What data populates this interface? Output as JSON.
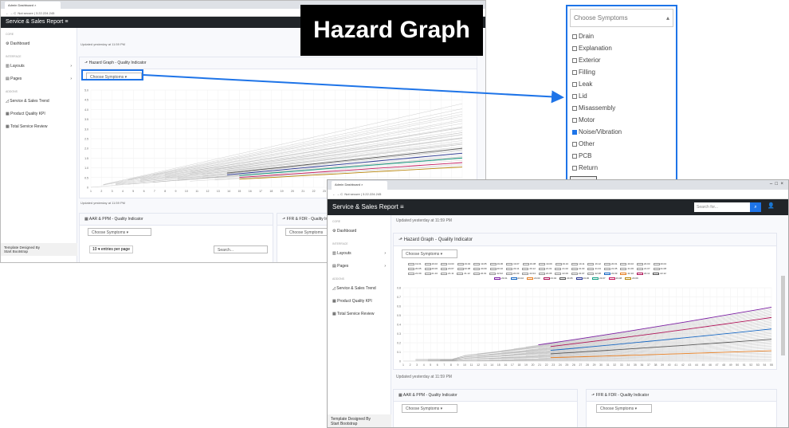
{
  "title_banner": "Hazard Graph",
  "win1": {
    "tab_title": "Admin Dashboard",
    "url": "Not secure | 3.22.224.245",
    "brand": "Service & Sales Report",
    "updated_top": "Updated yesterday at 11:59 PM",
    "card_title": "Hazard Graph - Quality Indicator",
    "select": "Choose Symptoms",
    "updated_bottom": "Updated yesterday at 11:59 PM",
    "aar_title": "AAR & PPM - Quality Indicator",
    "ffr_title": "FFR & FDR - Quality Indi",
    "entries": "10 ▾ entries per page",
    "search_ph": "Search...",
    "sidebar": {
      "core": "CORE",
      "dashboard": "Dashboard",
      "interface": "INTERFACE",
      "layouts": "Layouts",
      "pages": "Pages",
      "addons": "ADDONS",
      "trend": "Service & Sales Trend",
      "kpi": "Product Quality KPI",
      "review": "Total Service Review",
      "footer1": "Template Designed By",
      "footer2": "Start Bootstrap"
    },
    "y_ticks": [
      "5.0",
      "4.5",
      "4.0",
      "3.5",
      "3.0",
      "2.5",
      "2.0",
      "1.5",
      "1.0",
      "0.5",
      "0"
    ],
    "x_ticks": [
      "1",
      "2",
      "3",
      "4",
      "5",
      "6",
      "7",
      "8",
      "9",
      "10",
      "11",
      "12",
      "13",
      "14",
      "15",
      "16",
      "17",
      "18",
      "19",
      "20",
      "21",
      "22",
      "23",
      "24",
      "25",
      "26",
      "27",
      "28",
      "29",
      "30",
      "31",
      "32",
      "33",
      "34",
      "35",
      "36"
    ]
  },
  "dropdown": {
    "header": "Choose Symptoms",
    "options": [
      {
        "label": "Drain",
        "checked": false
      },
      {
        "label": "Explanation",
        "checked": false
      },
      {
        "label": "Exterior",
        "checked": false
      },
      {
        "label": "Filling",
        "checked": false
      },
      {
        "label": "Leak",
        "checked": false
      },
      {
        "label": "Lid",
        "checked": false
      },
      {
        "label": "Misassembly",
        "checked": false
      },
      {
        "label": "Motor",
        "checked": false
      },
      {
        "label": "Noise/Vibration",
        "checked": true
      },
      {
        "label": "Other",
        "checked": false
      },
      {
        "label": "PCB",
        "checked": false
      },
      {
        "label": "Return",
        "checked": false
      }
    ],
    "submit": "submit"
  },
  "win2": {
    "tab_title": "Admin Dashboard",
    "url": "Not secure | 3.22.224.245",
    "brand": "Service & Sales Report",
    "search_ph": "Search for...",
    "updated_top": "Updated yesterday at 11:59 PM",
    "card_title": "Hazard Graph - Quality Indicator",
    "select": "Choose Symptoms",
    "updated_bottom": "Updated yesterday at 11:59 PM",
    "aar_title": "AAR & PPM - Quality Indicator",
    "ffr_title": "FFR & FDR - Quality Indicator",
    "select2": "Choose Symptoms",
    "select3": "Choose Symptoms",
    "sidebar": {
      "core": "CORE",
      "dashboard": "Dashboard",
      "interface": "INTERFACE",
      "layouts": "Layouts",
      "pages": "Pages",
      "addons": "ADDONS",
      "trend": "Service & Sales Trend",
      "kpi": "Product Quality KPI",
      "review": "Total Service Review",
      "footer1": "Template Designed By",
      "footer2": "Start Bootstrap"
    },
    "legend_rows": [
      [
        "19.01",
        "19.02",
        "19.03",
        "19.04",
        "19.05",
        "19.06",
        "19.07",
        "19.08",
        "19.09",
        "19.10",
        "19.11",
        "19.12",
        "20.01",
        "20.02",
        "20.03",
        "20.04"
      ],
      [
        "20.05",
        "20.06",
        "20.07",
        "20.08",
        "20.09",
        "20.10",
        "20.11",
        "20.12",
        "21.01",
        "21.02",
        "21.03",
        "21.04",
        "21.05",
        "21.06",
        "21.07",
        "21.08"
      ],
      [
        "21.09",
        "21.10",
        "21.11",
        "21.12",
        "22.01",
        "22.02",
        "22.03",
        "22.04",
        "22.05",
        "22.06",
        "22.07",
        "22.08",
        "22.09",
        "22.10",
        "22.11",
        "22.12"
      ],
      [
        "23.01",
        "23.02",
        "23.03",
        "23.04",
        "23.05",
        "23.06",
        "23.07",
        "23.08",
        "23.09"
      ]
    ],
    "y_ticks": [
      "0.8",
      "0.7",
      "0.6",
      "0.5",
      "0.4",
      "0.3",
      "0.2",
      "0.1",
      "0"
    ],
    "x_ticks": [
      "1",
      "2",
      "3",
      "4",
      "5",
      "6",
      "7",
      "8",
      "9",
      "10",
      "11",
      "12",
      "13",
      "14",
      "15",
      "16",
      "17",
      "18",
      "19",
      "20",
      "21",
      "22",
      "23",
      "24",
      "25",
      "26",
      "27",
      "28",
      "29",
      "30",
      "31",
      "32",
      "33",
      "34",
      "35",
      "36",
      "37",
      "38",
      "39",
      "40",
      "41",
      "42",
      "43",
      "44",
      "45",
      "46",
      "47",
      "48",
      "49",
      "50",
      "51",
      "52",
      "53",
      "54",
      "55"
    ]
  }
}
